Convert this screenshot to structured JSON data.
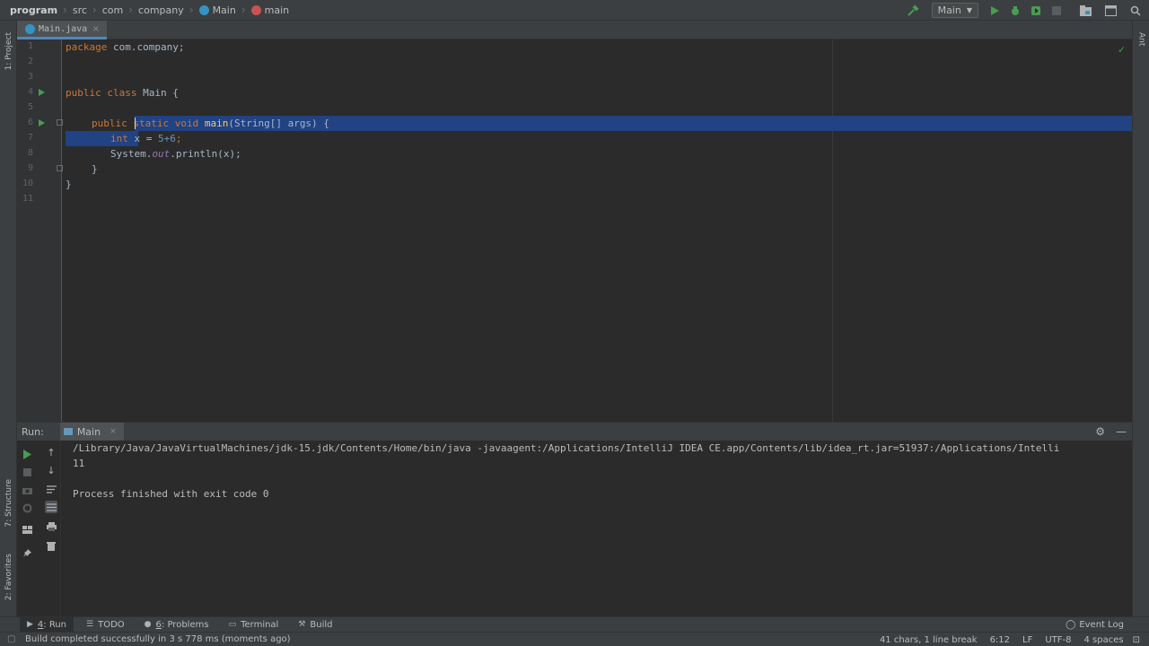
{
  "navbar": {
    "crumbs": [
      "program",
      "src",
      "com",
      "company",
      "Main",
      "main"
    ],
    "run_config": "Main"
  },
  "left_strip": {
    "project": "1: Project",
    "structure": "7: Structure",
    "favorites": "2: Favorites"
  },
  "right_strip": {
    "ant": "Ant"
  },
  "editor": {
    "tab_label": "Main.java",
    "line_numbers": [
      "1",
      "2",
      "3",
      "4",
      "5",
      "6",
      "7",
      "8",
      "9",
      "10",
      "11"
    ],
    "code": {
      "l1_kw": "package",
      "l1_rest": " com.company;",
      "l4_kw": "public class",
      "l4_rest": " Main {",
      "l6_kw1": "public",
      "l6_kw2": " static void ",
      "l6_fn": "main",
      "l6_rest": "(String[] args) {",
      "l7_kw": "int",
      "l7_mid": " x = ",
      "l7_num": "5+6",
      "l7_end": ";",
      "l8_a": "System.",
      "l8_out": "out",
      "l8_b": ".println(x);",
      "l9": "}",
      "l10": "}"
    }
  },
  "run_panel": {
    "label": "Run:",
    "tab": "Main",
    "console": [
      "/Library/Java/JavaVirtualMachines/jdk-15.jdk/Contents/Home/bin/java -javaagent:/Applications/IntelliJ IDEA CE.app/Contents/lib/idea_rt.jar=51937:/Applications/Intelli",
      "11",
      "",
      "Process finished with exit code 0"
    ]
  },
  "bottom_bar": {
    "tabs": [
      {
        "key": "4",
        "label": ": Run"
      },
      {
        "key": "",
        "label": "TODO"
      },
      {
        "key": "6",
        "label": ": Problems"
      },
      {
        "key": "",
        "label": "Terminal"
      },
      {
        "key": "",
        "label": "Build"
      }
    ],
    "event_log": "Event Log"
  },
  "status_bar": {
    "message": "Build completed successfully in 3 s 778 ms (moments ago)",
    "chars": "41 chars, 1 line break",
    "position": "6:12",
    "line_sep": "LF",
    "encoding": "UTF-8",
    "indent": "4 spaces"
  }
}
